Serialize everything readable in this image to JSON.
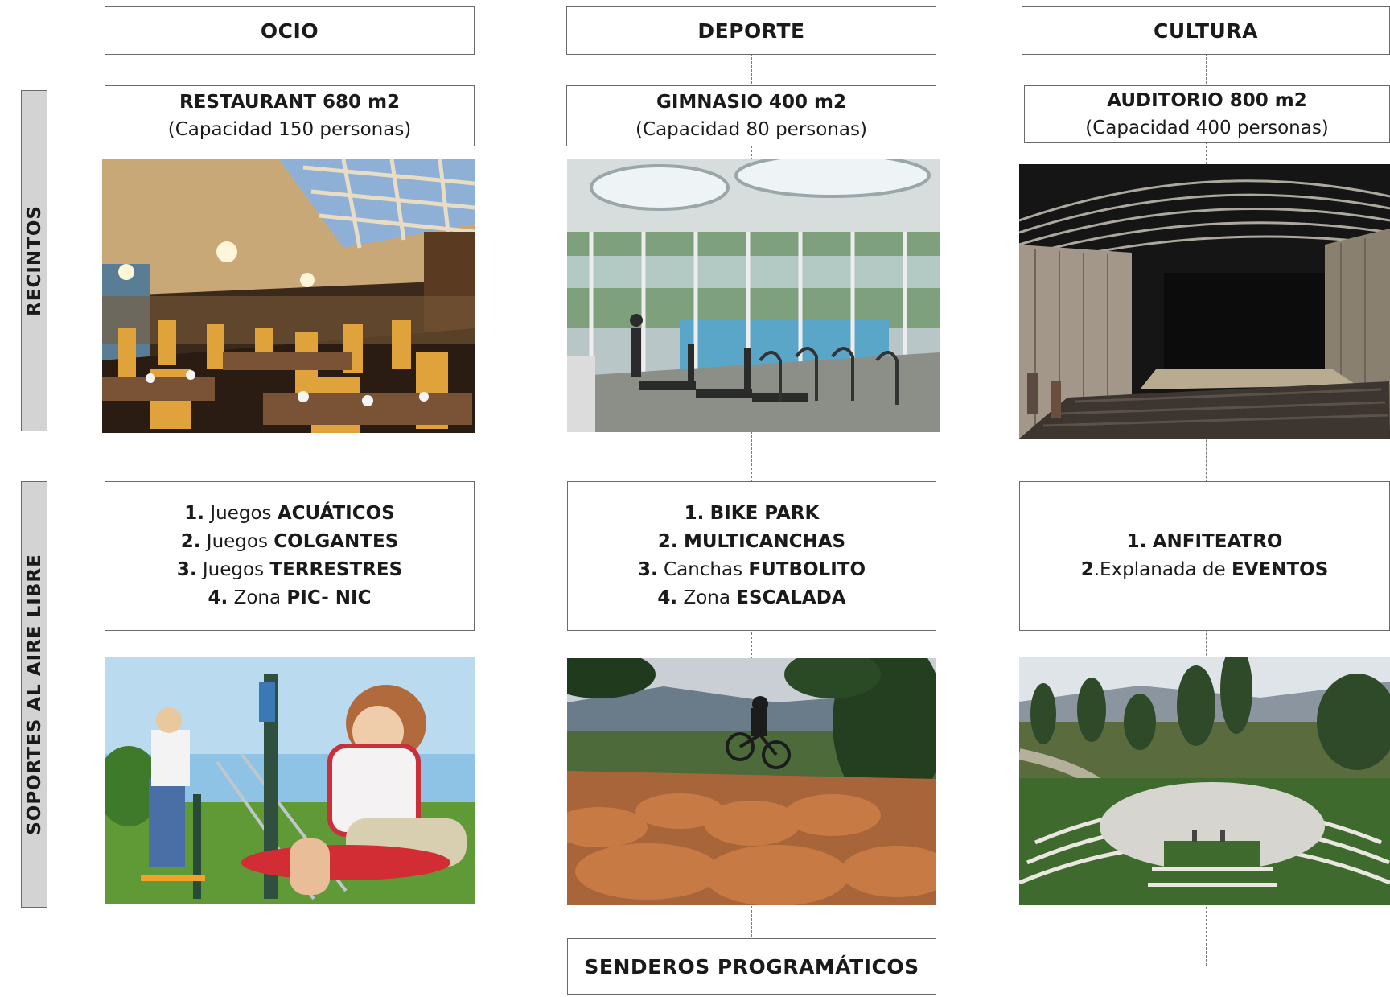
{
  "columns": [
    {
      "heading": "OCIO",
      "space_title": "RESTAURANT 680 m2",
      "space_capacity": "(Capacidad 150 personas)",
      "outdoor_items": [
        {
          "num": "1.",
          "pre": "Juegos",
          "key": "ACUÁTICOS"
        },
        {
          "num": "2.",
          "pre": "Juegos",
          "key": "COLGANTES"
        },
        {
          "num": "3.",
          "pre": "Juegos",
          "key": "TERRESTRES"
        },
        {
          "num": "4.",
          "pre": "Zona",
          "key": "PIC- NIC"
        }
      ]
    },
    {
      "heading": "DEPORTE",
      "space_title": "GIMNASIO 400 m2",
      "space_capacity": "(Capacidad 80 personas)",
      "outdoor_items": [
        {
          "num": "1.",
          "pre": "",
          "key": "BIKE PARK"
        },
        {
          "num": "2.",
          "pre": "",
          "key": "MULTICANCHAS"
        },
        {
          "num": "3.",
          "pre": "Canchas",
          "key": "FUTBOLITO"
        },
        {
          "num": "4.",
          "pre": "Zona",
          "key": "ESCALADA"
        }
      ]
    },
    {
      "heading": "CULTURA",
      "space_title": "AUDITORIO 800 m2",
      "space_capacity": "(Capacidad 400 personas)",
      "outdoor_items": [
        {
          "num": "1.",
          "pre": "",
          "key": "ANFITEATRO"
        },
        {
          "num": "2",
          "pre": ".Explanada de",
          "key": "EVENTOS"
        }
      ]
    }
  ],
  "sidebar": {
    "recintos": "RECINTOS",
    "soportes": "SOPORTES AL AIRE LIBRE"
  },
  "bottom_label": "SENDEROS PROGRAMÁTICOS",
  "colors": {
    "sidebar_bg": "#d3d3d3",
    "border": "#6a6a6a",
    "dashed_line": "#7a7a7a"
  }
}
